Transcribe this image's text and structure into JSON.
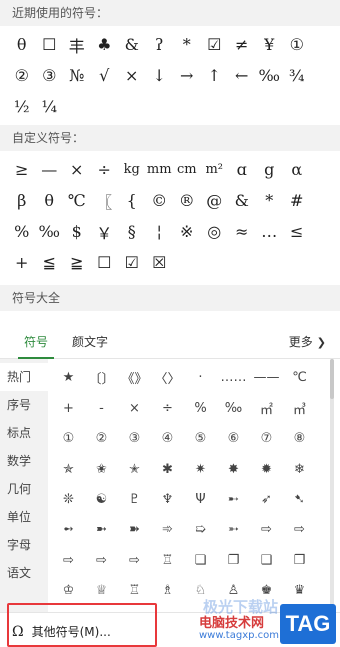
{
  "recent": {
    "header": "近期使用的符号：",
    "symbols": [
      "θ",
      "☐",
      "丰",
      "♣",
      "&",
      "ʔ",
      "*",
      "☑",
      "≠",
      "¥",
      "①",
      "②",
      "③",
      "№",
      "√",
      "×",
      "↓",
      "→",
      "↑",
      "←",
      "‰",
      "¾",
      "½",
      "¼"
    ]
  },
  "custom": {
    "header": "自定义符号：",
    "symbols": [
      "≥",
      "—",
      "×",
      "÷",
      "kg",
      "mm",
      "cm",
      "m²",
      "ɑ",
      "g",
      "α",
      "β",
      "θ",
      "℃",
      "〖",
      "{",
      "©",
      "®",
      "@",
      "&",
      "*",
      "#",
      "%",
      "‰",
      "$",
      "￥",
      "§",
      "¦",
      "※",
      "◎",
      "≈",
      "…",
      "≤",
      "+",
      "≦",
      "≧",
      "☐",
      "☑",
      "☒"
    ]
  },
  "all": {
    "header": "符号大全",
    "tabs": [
      "符号",
      "颜文字"
    ],
    "more": "更多",
    "categories": [
      "热门",
      "序号",
      "标点",
      "数学",
      "几何",
      "单位",
      "字母",
      "语文"
    ],
    "symbols": [
      "★",
      "〔〕",
      "《》",
      "〈〉",
      "·",
      "……",
      "——",
      "℃",
      "+",
      "-",
      "×",
      "÷",
      "%",
      "‰",
      "㎡",
      "㎥",
      "①",
      "②",
      "③",
      "④",
      "⑤",
      "⑥",
      "⑦",
      "⑧",
      "✯",
      "✬",
      "✭",
      "✱",
      "✷",
      "✸",
      "✹",
      "❄",
      "❊",
      "☯",
      "♇",
      "♆",
      "Ψ",
      "➸",
      "➶",
      "➷",
      "➻",
      "➼",
      "➽",
      "➾",
      "➯",
      "➵",
      "⇨",
      "⇨",
      "⇨",
      "⇨",
      "⇨",
      "♖",
      "❏",
      "❐",
      "❑",
      "❒",
      "♔",
      "♕",
      "♖",
      "♗",
      "♘",
      "♙",
      "♚",
      "♛",
      "♞",
      "♟",
      "⊙",
      "◉",
      "▨",
      "▧",
      "●",
      "◐"
    ]
  },
  "footer": {
    "other_symbols": "其他符号(M)..."
  },
  "watermark": {
    "line1": "极光下载站",
    "line2": "电脑技术网",
    "url": "www.tagxp.com",
    "badge": "TAG"
  }
}
